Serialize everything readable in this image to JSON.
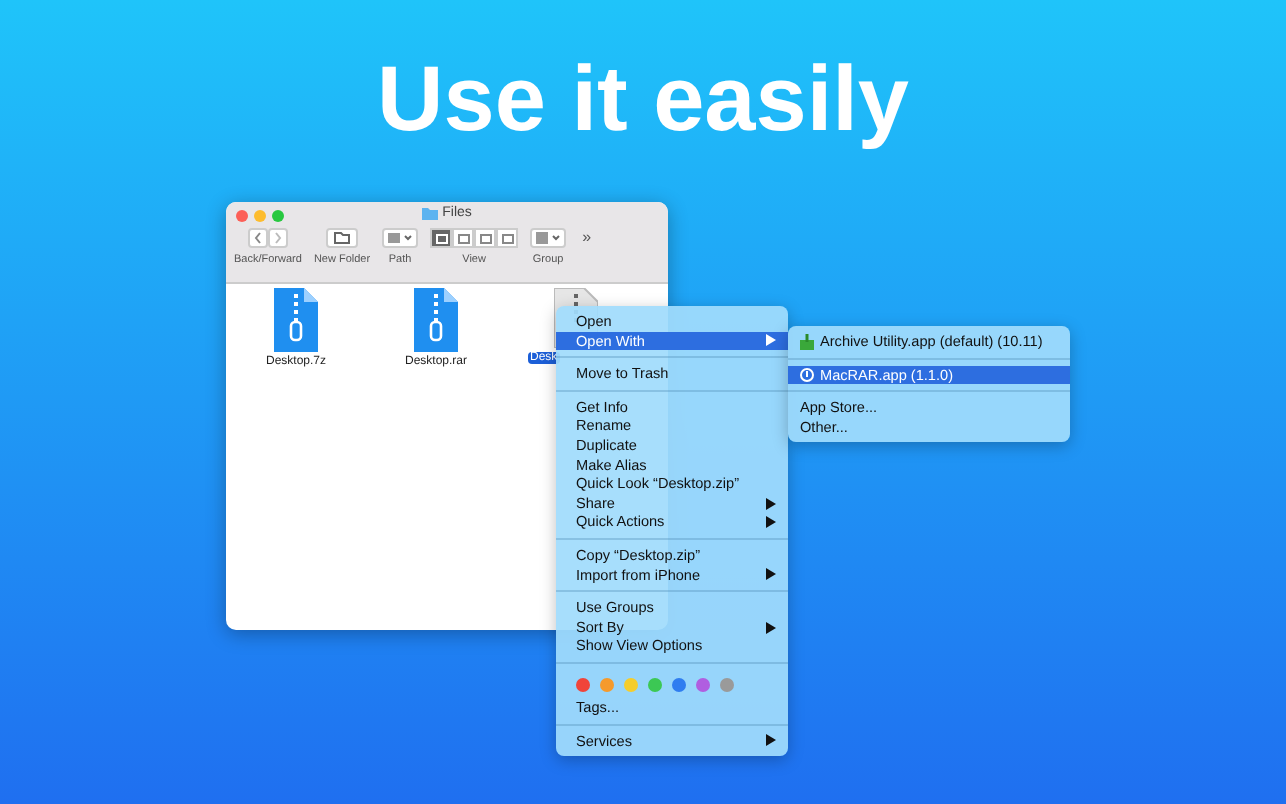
{
  "headline": "Use it easily",
  "window": {
    "title": "Files",
    "toolbar": [
      {
        "kind": "nav",
        "label": "Back/Forward"
      },
      {
        "kind": "folder",
        "label": "New Folder"
      },
      {
        "kind": "path",
        "label": "Path"
      },
      {
        "kind": "view",
        "label": "View",
        "modes": [
          {
            "selected": true
          },
          {
            "selected": false
          },
          {
            "selected": false
          },
          {
            "selected": false
          }
        ]
      },
      {
        "kind": "group",
        "label": "Group"
      }
    ],
    "more": "»",
    "files": [
      {
        "name": "Desktop.7z",
        "kind": "archive",
        "selected": false
      },
      {
        "name": "Desktop.rar",
        "kind": "archive",
        "selected": false
      },
      {
        "name": "Desk",
        "kind": "document",
        "selected": true
      }
    ]
  },
  "context_menu": {
    "sections": [
      [
        {
          "label": "Open",
          "selected": false,
          "submenu": false
        },
        {
          "label": "Open With",
          "selected": true,
          "submenu": true
        }
      ],
      [
        {
          "label": "Move to Trash",
          "selected": false,
          "submenu": false
        }
      ],
      [
        {
          "label": "Get Info",
          "selected": false,
          "submenu": false
        },
        {
          "label": "Rename",
          "selected": false,
          "submenu": false
        },
        {
          "label": "Duplicate",
          "selected": false,
          "submenu": false
        },
        {
          "label": "Make Alias",
          "selected": false,
          "submenu": false
        },
        {
          "label": "Quick Look “Desktop.zip”",
          "selected": false,
          "submenu": false
        },
        {
          "label": "Share",
          "selected": false,
          "submenu": true
        },
        {
          "label": "Quick Actions",
          "selected": false,
          "submenu": true
        }
      ],
      [
        {
          "label": "Copy “Desktop.zip”",
          "selected": false,
          "submenu": false
        },
        {
          "label": "Import from iPhone",
          "selected": false,
          "submenu": true
        }
      ],
      [
        {
          "label": "Use Groups",
          "selected": false,
          "submenu": false
        },
        {
          "label": "Sort By",
          "selected": false,
          "submenu": true
        },
        {
          "label": "Show View Options",
          "selected": false,
          "submenu": false
        }
      ]
    ],
    "tag_colors": [
      {
        "color": "#f0443a"
      },
      {
        "color": "#f59a2c"
      },
      {
        "color": "#f5cd2c"
      },
      {
        "color": "#3cc854"
      },
      {
        "color": "#2f7df0"
      },
      {
        "color": "#b05ee0"
      },
      {
        "color": "#9a9a9a"
      }
    ],
    "tags_label": "Tags...",
    "footer": [
      {
        "label": "Services",
        "selected": false,
        "submenu": true
      }
    ]
  },
  "submenu": {
    "sections": [
      [
        {
          "label": "Archive Utility.app (default) (10.11)",
          "kind": "archive-app",
          "selected": false
        }
      ],
      [
        {
          "label": "MacRAR.app (1.1.0)",
          "kind": "rar-app",
          "selected": true
        }
      ],
      [
        {
          "label": "App Store...",
          "kind": "plain",
          "selected": false
        },
        {
          "label": "Other...",
          "kind": "plain",
          "selected": false
        }
      ]
    ]
  }
}
